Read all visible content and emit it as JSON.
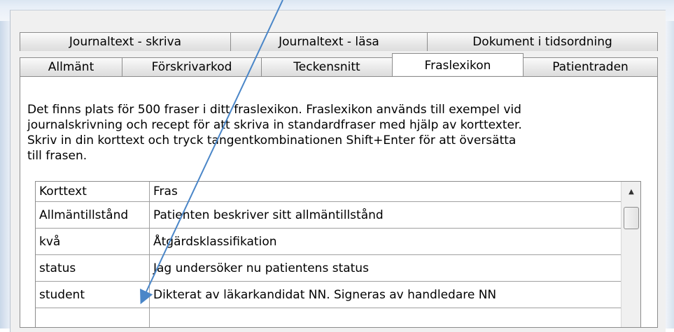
{
  "tabs_row1": [
    {
      "label": "Journaltext - skriva"
    },
    {
      "label": "Journaltext - läsa"
    },
    {
      "label": "Dokument i tidsordning"
    }
  ],
  "tabs_row2": [
    {
      "label": "Allmänt"
    },
    {
      "label": "Förskrivarkod"
    },
    {
      "label": "Teckensnitt"
    },
    {
      "label": "Fraslexikon",
      "active": true
    },
    {
      "label": "Patientraden"
    }
  ],
  "description": {
    "line1": "Det finns plats för 500 fraser i ditt fraslexikon. Fraslexikon används till exempel vid",
    "line2": "journalskrivning och recept för att skriva in standardfraser med hjälp av korttexter.",
    "line3": "Skriv in din korttext och tryck tangentkombinationen Shift+Enter för att översätta",
    "line4": "till frasen."
  },
  "table": {
    "columns": [
      "Korttext",
      "Fras"
    ],
    "rows": [
      [
        "Allmäntillstånd",
        "Patienten beskriver sitt allmäntillstånd"
      ],
      [
        "kvå",
        "Åtgärdsklassifikation"
      ],
      [
        "status",
        "Jag undersöker nu patientens status"
      ],
      [
        "student",
        "Dikterat av läkarkandidat NN. Signeras av handledare NN"
      ]
    ]
  },
  "icons": {
    "scroll_up": "scroll-up-arrow-icon"
  },
  "colors": {
    "arrow": "#4a86c8",
    "panel_border": "#8c8c8c"
  }
}
